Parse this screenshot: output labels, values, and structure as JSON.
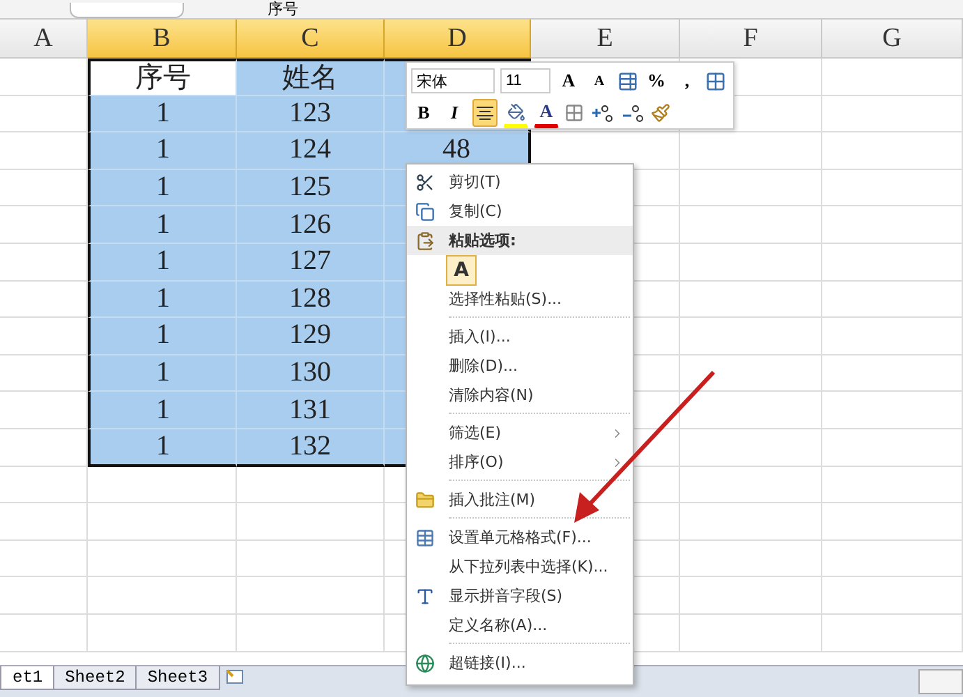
{
  "formula_bar": {
    "value": "序号"
  },
  "columns": [
    {
      "label": "A",
      "selected": false
    },
    {
      "label": "B",
      "selected": true
    },
    {
      "label": "C",
      "selected": true
    },
    {
      "label": "D",
      "selected": true
    },
    {
      "label": "E",
      "selected": false
    },
    {
      "label": "F",
      "selected": false
    },
    {
      "label": "G",
      "selected": false
    }
  ],
  "rows": [
    {
      "cells": [
        {
          "text": "",
          "selected": false
        },
        {
          "text": "序号",
          "selected": false,
          "active": true
        },
        {
          "text": "姓名",
          "selected": true
        },
        {
          "text": "",
          "selected": true
        }
      ]
    },
    {
      "cells": [
        {
          "text": "",
          "selected": false
        },
        {
          "text": "1",
          "selected": true
        },
        {
          "text": "123",
          "selected": true
        },
        {
          "text": "",
          "selected": true
        }
      ]
    },
    {
      "cells": [
        {
          "text": "",
          "selected": false
        },
        {
          "text": "1",
          "selected": true
        },
        {
          "text": "124",
          "selected": true
        },
        {
          "text": "48",
          "selected": true
        }
      ]
    },
    {
      "cells": [
        {
          "text": "",
          "selected": false
        },
        {
          "text": "1",
          "selected": true
        },
        {
          "text": "125",
          "selected": true
        },
        {
          "text": "",
          "selected": true
        }
      ]
    },
    {
      "cells": [
        {
          "text": "",
          "selected": false
        },
        {
          "text": "1",
          "selected": true
        },
        {
          "text": "126",
          "selected": true
        },
        {
          "text": "",
          "selected": true
        }
      ]
    },
    {
      "cells": [
        {
          "text": "",
          "selected": false
        },
        {
          "text": "1",
          "selected": true
        },
        {
          "text": "127",
          "selected": true
        },
        {
          "text": "",
          "selected": true
        }
      ]
    },
    {
      "cells": [
        {
          "text": "",
          "selected": false
        },
        {
          "text": "1",
          "selected": true
        },
        {
          "text": "128",
          "selected": true
        },
        {
          "text": "",
          "selected": true
        }
      ]
    },
    {
      "cells": [
        {
          "text": "",
          "selected": false
        },
        {
          "text": "1",
          "selected": true
        },
        {
          "text": "129",
          "selected": true
        },
        {
          "text": "",
          "selected": true
        }
      ]
    },
    {
      "cells": [
        {
          "text": "",
          "selected": false
        },
        {
          "text": "1",
          "selected": true
        },
        {
          "text": "130",
          "selected": true
        },
        {
          "text": "",
          "selected": true
        }
      ]
    },
    {
      "cells": [
        {
          "text": "",
          "selected": false
        },
        {
          "text": "1",
          "selected": true
        },
        {
          "text": "131",
          "selected": true
        },
        {
          "text": "",
          "selected": true
        }
      ]
    },
    {
      "cells": [
        {
          "text": "",
          "selected": false
        },
        {
          "text": "1",
          "selected": true
        },
        {
          "text": "132",
          "selected": true
        },
        {
          "text": "",
          "selected": true
        }
      ]
    }
  ],
  "mini_toolbar": {
    "font": "宋体",
    "size": "11",
    "row_1": [
      {
        "kind": "grow-font",
        "label": "A"
      },
      {
        "kind": "shrink-font",
        "label": "A"
      },
      {
        "kind": "table-style"
      },
      {
        "kind": "text",
        "label": "%"
      },
      {
        "kind": "text",
        "label": ","
      },
      {
        "kind": "merge"
      }
    ],
    "row_2": [
      {
        "kind": "bold",
        "label": "B",
        "pressed": false
      },
      {
        "kind": "italic",
        "label": "I",
        "pressed": false
      },
      {
        "kind": "align-center",
        "pressed": true
      },
      {
        "kind": "fill-color",
        "color": "#ffff00"
      },
      {
        "kind": "font-color",
        "label": "A",
        "color": "#e00000"
      },
      {
        "kind": "borders"
      },
      {
        "kind": "increase-decimal"
      },
      {
        "kind": "decrease-decimal"
      },
      {
        "kind": "format-painter"
      }
    ]
  },
  "context_menu": [
    {
      "kind": "cut",
      "label": "剪切(T)"
    },
    {
      "kind": "copy",
      "label": "复制(C)"
    },
    {
      "kind": "header",
      "label": "粘贴选项:"
    },
    {
      "kind": "paste",
      "label": "A"
    },
    {
      "kind": "item",
      "label": "选择性粘贴(S)..."
    },
    {
      "kind": "separator"
    },
    {
      "kind": "item",
      "label": "插入(I)..."
    },
    {
      "kind": "item",
      "label": "删除(D)..."
    },
    {
      "kind": "item",
      "label": "清除内容(N)"
    },
    {
      "kind": "separator"
    },
    {
      "kind": "submenu",
      "label": "筛选(E)"
    },
    {
      "kind": "submenu",
      "label": "排序(O)"
    },
    {
      "kind": "separator"
    },
    {
      "kind": "comment",
      "label": "插入批注(M)"
    },
    {
      "kind": "separator"
    },
    {
      "kind": "format-cells",
      "label": "设置单元格格式(F)..."
    },
    {
      "kind": "item",
      "label": "从下拉列表中选择(K)..."
    },
    {
      "kind": "phonetic",
      "label": "显示拼音字段(S)"
    },
    {
      "kind": "item",
      "label": "定义名称(A)..."
    },
    {
      "kind": "separator"
    },
    {
      "kind": "hyperlink",
      "label": "超链接(I)..."
    }
  ],
  "sheet_tabs": [
    {
      "label": "et1",
      "selected": true
    },
    {
      "label": "Sheet2",
      "selected": false
    },
    {
      "label": "Sheet3",
      "selected": false
    }
  ]
}
